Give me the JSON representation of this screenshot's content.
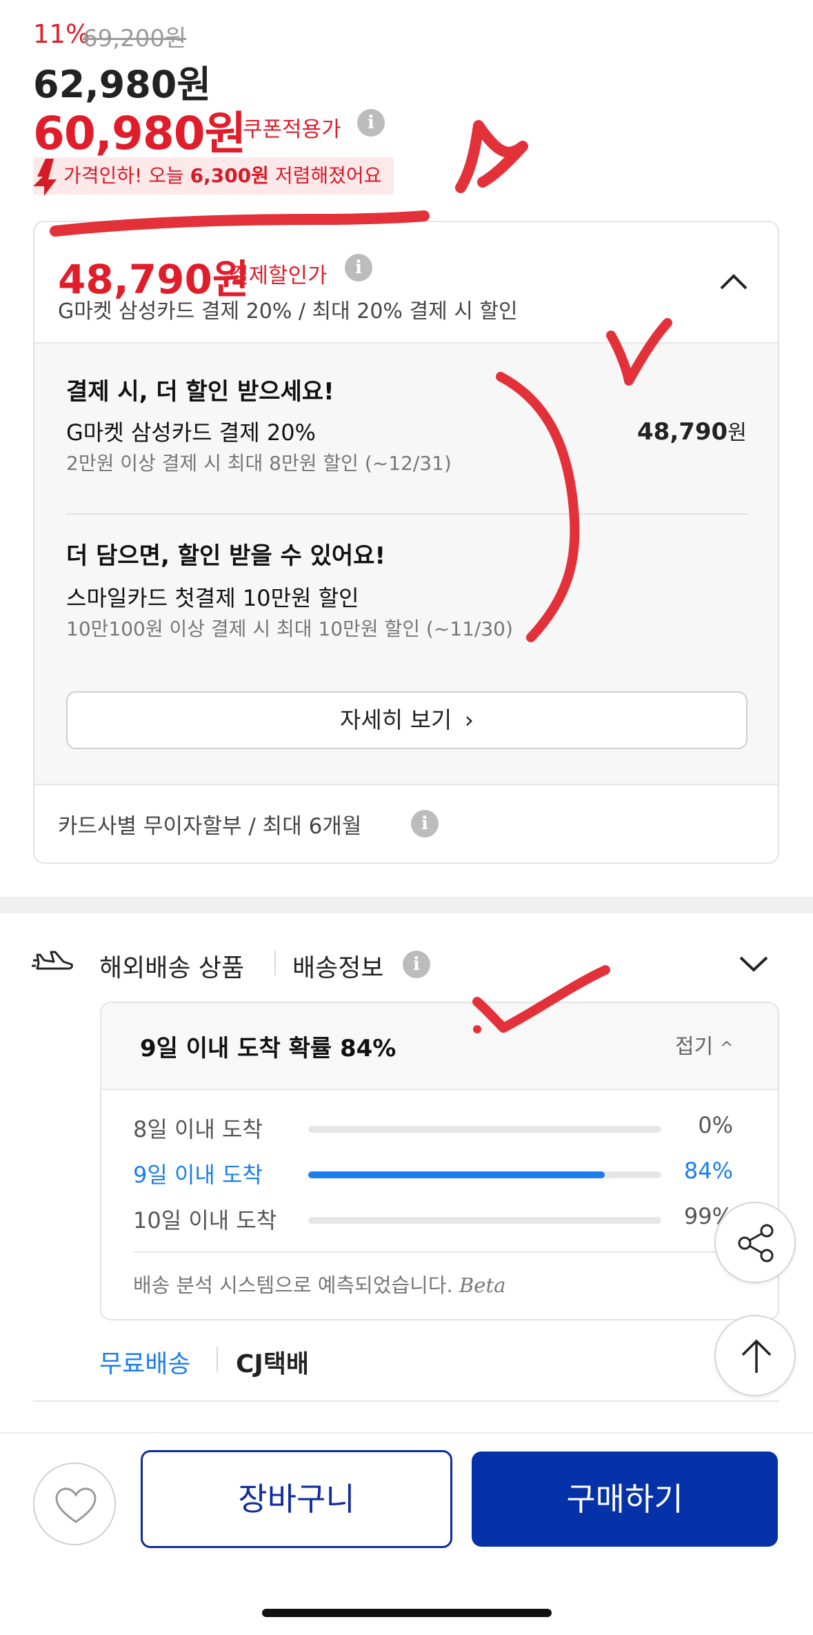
{
  "price": {
    "discount_rate": "11%",
    "original_price": "69,200원",
    "sale_price": "62,980원",
    "coupon_price": "60,980원",
    "coupon_label": "쿠폰적용가",
    "info_glyph": "i",
    "price_drop": {
      "prefix": "가격인하! 오늘 ",
      "amount": "6,300원",
      "suffix": " 저렴해졌어요"
    }
  },
  "payment_discount": {
    "price": "48,790원",
    "label": "결제할인가",
    "subtitle": "G마켓 삼성카드 결제 20% / 최대 20% 결제 시 할인",
    "section1_title": "결제 시, 더 할인 받으세요!",
    "card_offer_name": "G마켓 삼성카드 결제 20%",
    "card_offer_desc": "2만원 이상 결제 시 최대 8만원 할인 (~12/31)",
    "card_offer_amount": "48,790",
    "card_offer_unit": "원",
    "section2_title": "더 담으면, 할인 받을 수 있어요!",
    "smile_offer_name": "스마일카드 첫결제 10만원 할인",
    "smile_offer_desc": "10만100원 이상 결제 시 최대 10만원 할인 (~11/30)",
    "detail_button": "자세히 보기",
    "detail_chevron": "›",
    "installment": "카드사별 무이자할부 / 최대 6개월"
  },
  "shipping": {
    "type_label": "해외배송 상품",
    "info_label": "배송정보",
    "arrival_title": "9일 이내 도착 확률 84%",
    "collapse_label": "접기",
    "collapse_chevron": "^",
    "probabilities": [
      {
        "label": "8일 이내 도착",
        "value": "0%",
        "fraction": 0.0,
        "highlight": false
      },
      {
        "label": "9일 이내 도착",
        "value": "84%",
        "fraction": 0.84,
        "highlight": true
      },
      {
        "label": "10일 이내 도착",
        "value": "99%",
        "fraction": 0.99,
        "highlight": false
      }
    ],
    "note": "배송 분석 시스템으로 예측되었습니다.",
    "note_beta": "Beta",
    "free_shipping": "무료배송",
    "carrier": "CJ택배"
  },
  "bottom_bar": {
    "cart_button": "장바구니",
    "buy_button": "구매하기"
  },
  "colors": {
    "accent_red": "#e01e2b",
    "accent_blue": "#1a7ef0",
    "brand_navy": "#0532a8"
  },
  "icons": [
    "info-icon",
    "price-drop-arrow-icon",
    "chevron-up-icon",
    "chevron-down-icon",
    "overseas-shipping-icon",
    "share-icon",
    "scroll-top-icon",
    "heart-icon"
  ]
}
